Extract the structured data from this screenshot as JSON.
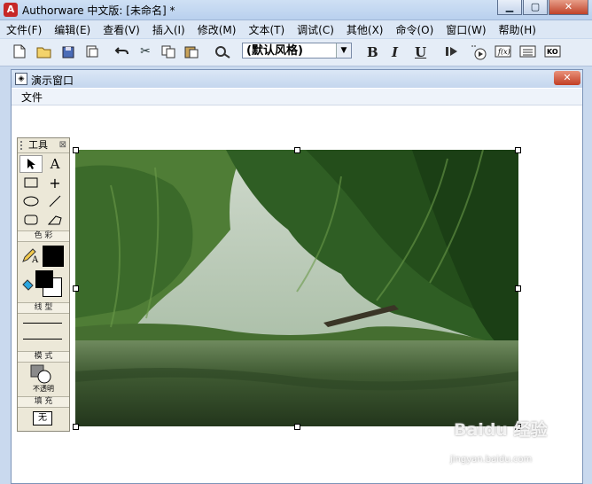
{
  "app": {
    "title": "Authorware 中文版: [未命名] *"
  },
  "menubar": {
    "items": [
      "文件(F)",
      "编辑(E)",
      "查看(V)",
      "插入(I)",
      "修改(M)",
      "文本(T)",
      "调试(C)",
      "其他(X)",
      "命令(O)",
      "窗口(W)",
      "帮助(H)"
    ]
  },
  "toolbar": {
    "style_value": "(默认风格)",
    "bold_label": "B",
    "italic_label": "I",
    "underline_label": "U"
  },
  "presentation": {
    "title": "演示窗口",
    "menu_file": "文件",
    "image": "bamboo-river-landscape-photo"
  },
  "tools": {
    "title": "工具",
    "color_section": "色 彩",
    "line_section": "线 型",
    "mode_section": "模 式",
    "mode_value": "不透明",
    "fill_section": "填 充",
    "fill_value": "无"
  },
  "watermark": {
    "text": "Baidu 经验",
    "url": "jingyan.baidu.com"
  }
}
